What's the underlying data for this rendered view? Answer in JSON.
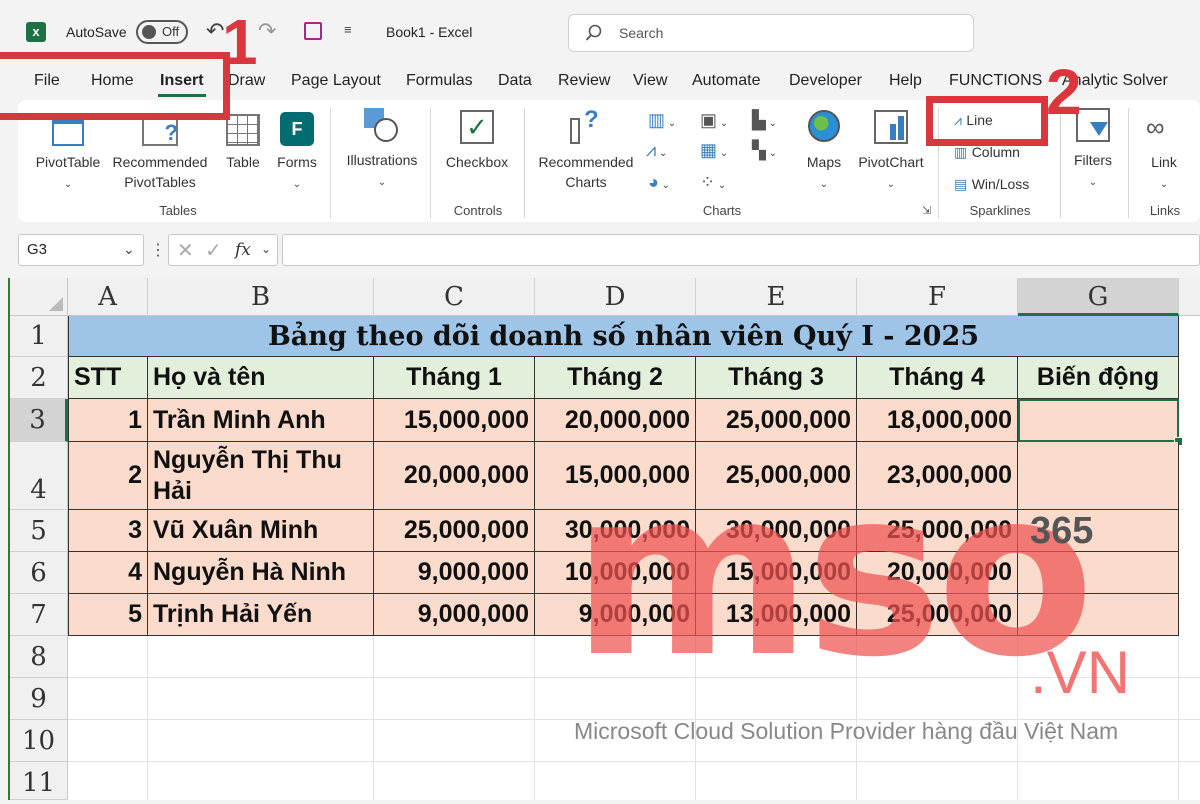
{
  "titlebar": {
    "autosave_label": "AutoSave",
    "autosave_state": "Off",
    "doc_title": "Book1 - Excel",
    "search_placeholder": "Search"
  },
  "menu_tabs": [
    "File",
    "Home",
    "Insert",
    "Draw",
    "Page Layout",
    "Formulas",
    "Data",
    "Review",
    "View",
    "Automate",
    "Developer",
    "Help",
    "FUNCTIONS",
    "Analytic Solver"
  ],
  "active_tab": "Insert",
  "ribbon": {
    "groups": [
      "Tables",
      "Controls",
      "Charts",
      "Sparklines",
      "Links"
    ],
    "pivottable": "PivotTable",
    "rec_pivot_1": "Recommended",
    "rec_pivot_2": "PivotTables",
    "table": "Table",
    "forms": "Forms",
    "illustrations": "Illustrations",
    "checkbox": "Checkbox",
    "rec_charts_1": "Recommended",
    "rec_charts_2": "Charts",
    "maps": "Maps",
    "pivotchart": "PivotChart",
    "spark_line": "Line",
    "spark_column": "Column",
    "spark_winloss": "Win/Loss",
    "filters": "Filters",
    "link": "Link"
  },
  "formula_bar": {
    "name_box": "G3",
    "fx": "fx",
    "formula": ""
  },
  "sheet": {
    "columns": [
      "A",
      "B",
      "C",
      "D",
      "E",
      "F",
      "G"
    ],
    "rows": [
      "1",
      "2",
      "3",
      "4",
      "5",
      "6",
      "7",
      "8",
      "9",
      "10",
      "11"
    ],
    "title": "Bảng theo dõi doanh số nhân viên Quý I - 2025",
    "headers": [
      "STT",
      "Họ và tên",
      "Tháng 1",
      "Tháng 2",
      "Tháng 3",
      "Tháng 4",
      "Biến động"
    ],
    "data": [
      [
        "1",
        "Trần Minh Anh",
        "15,000,000",
        "20,000,000",
        "25,000,000",
        "18,000,000",
        ""
      ],
      [
        "2",
        "Nguyễn Thị Thu Hải",
        "20,000,000",
        "15,000,000",
        "25,000,000",
        "23,000,000",
        ""
      ],
      [
        "3",
        "Vũ Xuân Minh",
        "25,000,000",
        "30,000,000",
        "30,000,000",
        "25,000,000",
        ""
      ],
      [
        "4",
        "Nguyễn Hà Ninh",
        "9,000,000",
        "10,000,000",
        "15,000,000",
        "20,000,000",
        ""
      ],
      [
        "5",
        "Trịnh Hải Yến",
        "9,000,000",
        "9,000,000",
        "13,000,000",
        "25,000,000",
        ""
      ]
    ],
    "selected_cell": "G3"
  },
  "step_markers": [
    "1",
    "2"
  ],
  "watermark": {
    "brand": "mso",
    "number": "365",
    "domain": ".VN",
    "tagline": "Microsoft Cloud Solution Provider hàng đầu Việt Nam"
  },
  "colors": {
    "title_fill": "#9ec5e8",
    "header_fill": "#e2efda",
    "data_fill": "#fbdccc",
    "highlight_red": "#d9363e",
    "excel_green": "#1e7145"
  }
}
